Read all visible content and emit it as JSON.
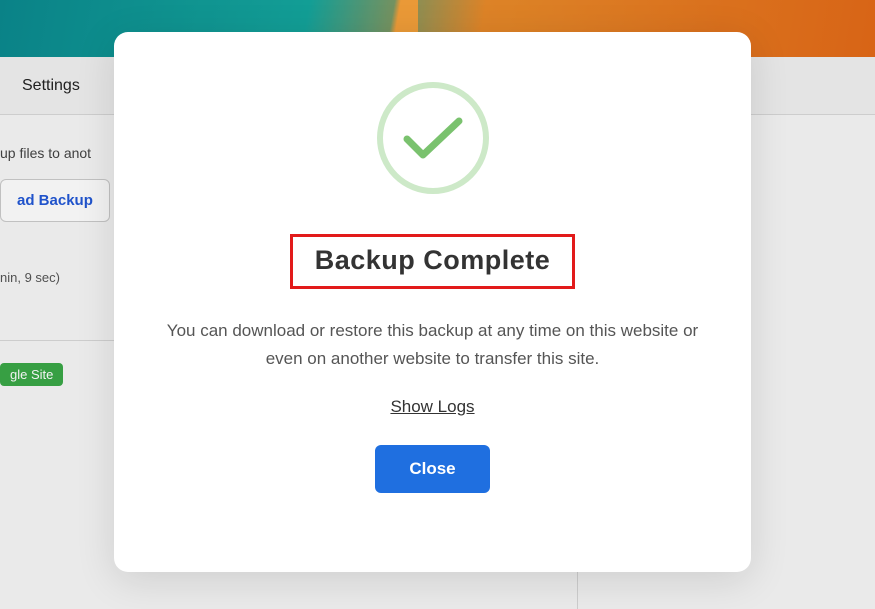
{
  "tabs": {
    "settings_label": "Settings"
  },
  "background": {
    "desc_prefix": "up files to anot",
    "download_button_fragment": "ad Backup",
    "meta_fragment": "nin, 9 sec)",
    "badge_fragment": "gle Site"
  },
  "modal": {
    "title": "Backup Complete",
    "body": "You can download or restore this backup at any time on this website or even on another website to transfer this site.",
    "show_logs_label": "Show Logs",
    "close_label": "Close"
  }
}
